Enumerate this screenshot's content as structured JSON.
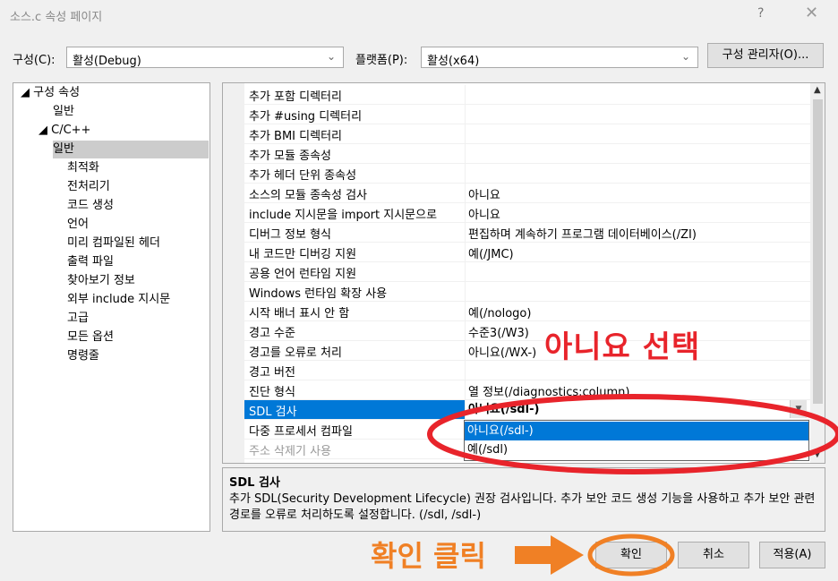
{
  "window": {
    "title": "소스.c 속성 페이지",
    "help": "?",
    "close": "✕"
  },
  "top": {
    "config_label": "구성(C):",
    "config_value": "활성(Debug)",
    "platform_label": "플랫폼(P):",
    "platform_value": "활성(x64)",
    "manager_button": "구성 관리자(O)..."
  },
  "tree": [
    {
      "label": "◢ 구성 속성"
    },
    {
      "label": "일반"
    },
    {
      "label": "◢ C/C++"
    },
    {
      "label": "일반"
    },
    {
      "label": "최적화"
    },
    {
      "label": "전처리기"
    },
    {
      "label": "코드 생성"
    },
    {
      "label": "언어"
    },
    {
      "label": "미리 컴파일된 헤더"
    },
    {
      "label": "출력 파일"
    },
    {
      "label": "찾아보기 정보"
    },
    {
      "label": "외부 include 지시문"
    },
    {
      "label": "고급"
    },
    {
      "label": "모든 옵션"
    },
    {
      "label": "명령줄"
    }
  ],
  "properties": [
    {
      "name": "추가 포함 디렉터리",
      "value": ""
    },
    {
      "name": "추가 #using 디렉터리",
      "value": ""
    },
    {
      "name": "추가 BMI 디렉터리",
      "value": ""
    },
    {
      "name": "추가 모듈 종속성",
      "value": ""
    },
    {
      "name": "추가 헤더 단위 종속성",
      "value": ""
    },
    {
      "name": "소스의 모듈 종속성 검사",
      "value": "아니요"
    },
    {
      "name": "include 지시문을 import 지시문으로",
      "value": "아니요"
    },
    {
      "name": "디버그 정보 형식",
      "value": "편집하며 계속하기 프로그램 데이터베이스(/ZI)"
    },
    {
      "name": "내 코드만 디버깅 지원",
      "value": "예(/JMC)"
    },
    {
      "name": "공용 언어 런타임 지원",
      "value": ""
    },
    {
      "name": "Windows 런타임 확장 사용",
      "value": ""
    },
    {
      "name": "시작 배너 표시 안 함",
      "value": "예(/nologo)"
    },
    {
      "name": "경고 수준",
      "value": "수준3(/W3)"
    },
    {
      "name": "경고를 오류로 처리",
      "value": "아니요(/WX-)"
    },
    {
      "name": "경고 버전",
      "value": ""
    },
    {
      "name": "진단 형식",
      "value": "열 정보(/diagnostics:column)"
    },
    {
      "name": "SDL 검사",
      "value": "아니요(/sdl-)"
    },
    {
      "name": "다중 프로세서 컴파일",
      "value": ""
    },
    {
      "name": "주소 삭제기 사용",
      "value": ""
    }
  ],
  "dropdown_options": [
    "아니요(/sdl-)",
    "예(/sdl)"
  ],
  "description": {
    "title": "SDL 검사",
    "body": "추가 SDL(Security Development Lifecycle) 권장 검사입니다. 추가 보안 코드 생성 기능을 사용하고 추가 보안 관련 경로를 오류로 처리하도록 설정합니다. (/sdl, /sdl-)"
  },
  "buttons": {
    "ok": "확인",
    "cancel": "취소",
    "apply": "적용(A)"
  },
  "annotations": {
    "select_no": "아니요 선택",
    "click_ok": "확인 클릭",
    "red_color": "#e8242b",
    "orange_color": "#f08025"
  }
}
